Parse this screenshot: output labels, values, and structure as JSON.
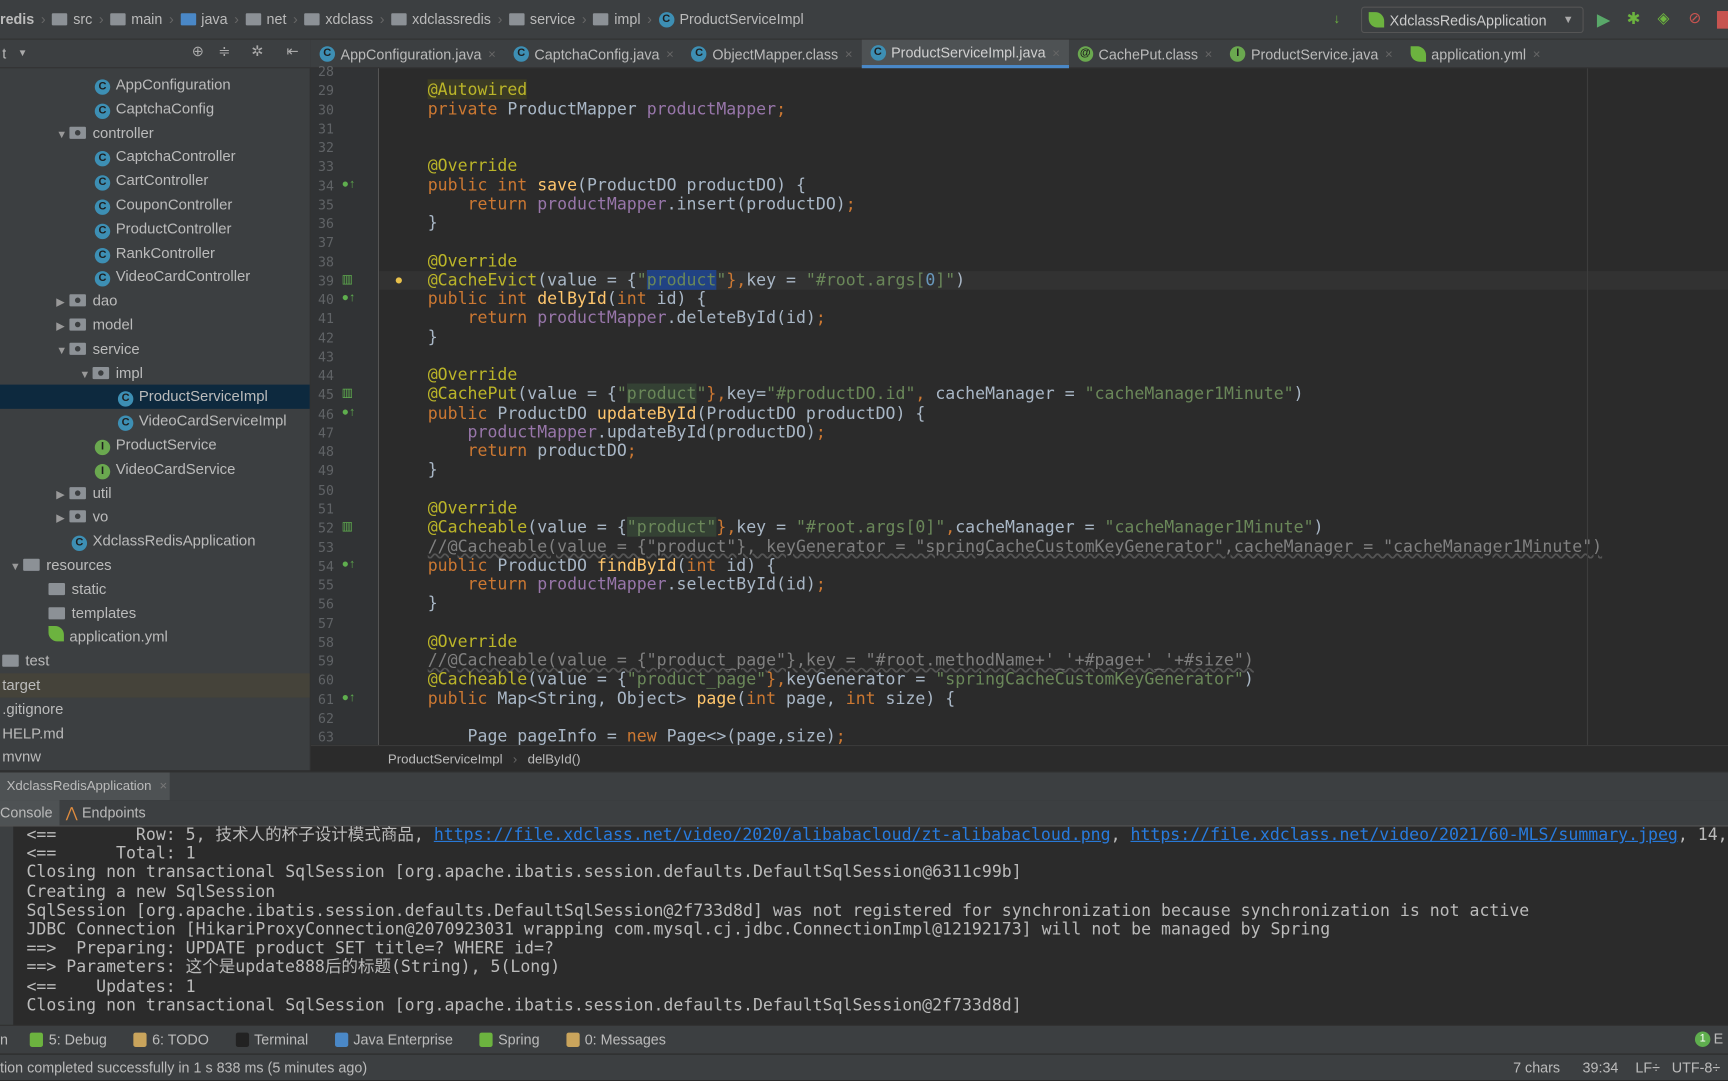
{
  "navbar": {
    "crumbs": [
      {
        "label": "redis",
        "icon": "none"
      },
      {
        "label": "src",
        "icon": "folder-icon"
      },
      {
        "label": "main",
        "icon": "folder-icon"
      },
      {
        "label": "java",
        "icon": "source-folder-icon"
      },
      {
        "label": "net",
        "icon": "package-icon"
      },
      {
        "label": "xdclass",
        "icon": "package-icon"
      },
      {
        "label": "xdclassredis",
        "icon": "package-icon"
      },
      {
        "label": "service",
        "icon": "package-icon"
      },
      {
        "label": "impl",
        "icon": "package-icon"
      },
      {
        "label": "ProductServiceImpl",
        "icon": "class-icon"
      }
    ],
    "run_config": "XdclassRedisApplication"
  },
  "project": {
    "label": "t"
  },
  "tabs": [
    {
      "label": "AppConfiguration.java",
      "icon": "C"
    },
    {
      "label": "CaptchaConfig.java",
      "icon": "C"
    },
    {
      "label": "ObjectMapper.class",
      "icon": "C"
    },
    {
      "label": "ProductServiceImpl.java",
      "icon": "C",
      "active": true
    },
    {
      "label": "CachePut.class",
      "icon": "@"
    },
    {
      "label": "ProductService.java",
      "icon": "I"
    },
    {
      "label": "application.yml",
      "icon": "leaf"
    }
  ],
  "tree": [
    {
      "label": "AppConfiguration",
      "lvl": 4,
      "type": "C"
    },
    {
      "label": "CaptchaConfig",
      "lvl": 4,
      "type": "C"
    },
    {
      "label": "controller",
      "lvl": 3,
      "type": "pkg",
      "open": true
    },
    {
      "label": "CaptchaController",
      "lvl": 4,
      "type": "C"
    },
    {
      "label": "CartController",
      "lvl": 4,
      "type": "C"
    },
    {
      "label": "CouponController",
      "lvl": 4,
      "type": "C"
    },
    {
      "label": "ProductController",
      "lvl": 4,
      "type": "C"
    },
    {
      "label": "RankController",
      "lvl": 4,
      "type": "C"
    },
    {
      "label": "VideoCardController",
      "lvl": 4,
      "type": "C"
    },
    {
      "label": "dao",
      "lvl": 3,
      "type": "pkg",
      "open": false
    },
    {
      "label": "model",
      "lvl": 3,
      "type": "pkg",
      "open": false
    },
    {
      "label": "service",
      "lvl": 3,
      "type": "pkg",
      "open": true
    },
    {
      "label": "impl",
      "lvl": 4,
      "type": "pkg",
      "open": true
    },
    {
      "label": "ProductServiceImpl",
      "lvl": 5,
      "type": "C",
      "selected": true
    },
    {
      "label": "VideoCardServiceImpl",
      "lvl": 5,
      "type": "C"
    },
    {
      "label": "ProductService",
      "lvl": 4,
      "type": "I"
    },
    {
      "label": "VideoCardService",
      "lvl": 4,
      "type": "I"
    },
    {
      "label": "util",
      "lvl": 3,
      "type": "pkg",
      "open": false
    },
    {
      "label": "vo",
      "lvl": 3,
      "type": "pkg",
      "open": false
    },
    {
      "label": "XdclassRedisApplication",
      "lvl": 3,
      "type": "app"
    },
    {
      "label": "resources",
      "lvl": 1,
      "type": "folder",
      "open": true
    },
    {
      "label": "static",
      "lvl": 2,
      "type": "folder"
    },
    {
      "label": "templates",
      "lvl": 2,
      "type": "folder"
    },
    {
      "label": "application.yml",
      "lvl": 2,
      "type": "yml"
    },
    {
      "label": "test",
      "lvl": 0,
      "type": "folder"
    },
    {
      "label": "target",
      "lvl": 0,
      "type": "none",
      "target": true
    },
    {
      "label": ".gitignore",
      "lvl": 0,
      "type": "none"
    },
    {
      "label": "HELP.md",
      "lvl": 0,
      "type": "none"
    },
    {
      "label": "mvnw",
      "lvl": 0,
      "type": "none"
    }
  ],
  "editor": {
    "first_line": 28,
    "current_line": 39,
    "gutter_icons": {
      "34": "override-icon",
      "39": "cache-icon",
      "40": "override-icon",
      "45": "cache-icon",
      "46": "override-icon",
      "52": "cache-icon",
      "54": "override-icon",
      "61": "override-icon"
    },
    "lines": [
      [],
      [
        [
          "    ",
          ""
        ],
        [
          "@Autowired",
          "a abg"
        ]
      ],
      [
        [
          "    ",
          ""
        ],
        [
          "private ",
          "k"
        ],
        [
          "ProductMapper ",
          ""
        ],
        [
          "productMapper",
          "f"
        ],
        [
          ";",
          "k"
        ]
      ],
      [],
      [],
      [
        [
          "    ",
          ""
        ],
        [
          "@Override",
          "a"
        ]
      ],
      [
        [
          "    ",
          ""
        ],
        [
          "public int ",
          "k"
        ],
        [
          "save",
          "m"
        ],
        [
          "(ProductDO productDO) {",
          ""
        ]
      ],
      [
        [
          "        ",
          ""
        ],
        [
          "return ",
          "k"
        ],
        [
          "productMapper",
          "f"
        ],
        [
          ".insert(productDO)",
          ""
        ],
        [
          ";",
          "k"
        ]
      ],
      [
        [
          "    }",
          ""
        ]
      ],
      [],
      [
        [
          "    ",
          ""
        ],
        [
          "@Override",
          "a"
        ]
      ],
      [
        [
          "    ",
          ""
        ],
        [
          "@CacheEvict",
          "a"
        ],
        [
          "(value = {",
          ""
        ],
        [
          "\"",
          "s"
        ],
        [
          "product",
          "s hl"
        ],
        [
          "\"",
          "s"
        ],
        [
          "},",
          "k"
        ],
        [
          "key = ",
          ""
        ],
        [
          "\"#root.args[",
          "s"
        ],
        [
          "0",
          "n"
        ],
        [
          "]\"",
          "s"
        ],
        [
          ")",
          ""
        ]
      ],
      [
        [
          "    ",
          ""
        ],
        [
          "public int ",
          "k"
        ],
        [
          "delById",
          "m"
        ],
        [
          "(",
          ""
        ],
        [
          "int ",
          "k"
        ],
        [
          "id) {",
          ""
        ]
      ],
      [
        [
          "        ",
          ""
        ],
        [
          "return ",
          "k"
        ],
        [
          "productMapper",
          "f"
        ],
        [
          ".deleteById(id)",
          ""
        ],
        [
          ";",
          "k"
        ]
      ],
      [
        [
          "    }",
          ""
        ]
      ],
      [],
      [
        [
          "    ",
          ""
        ],
        [
          "@Override",
          "a"
        ]
      ],
      [
        [
          "    ",
          ""
        ],
        [
          "@CachePut",
          "a"
        ],
        [
          "(value = {",
          ""
        ],
        [
          "\"",
          "s"
        ],
        [
          "product",
          "s hg"
        ],
        [
          "\"",
          "s"
        ],
        [
          "},",
          "k"
        ],
        [
          "key=",
          ""
        ],
        [
          "\"#productDO.id\"",
          "s"
        ],
        [
          ", ",
          "k"
        ],
        [
          "cacheManager = ",
          ""
        ],
        [
          "\"cacheManager1Minute\"",
          "s"
        ],
        [
          ")",
          ""
        ]
      ],
      [
        [
          "    ",
          ""
        ],
        [
          "public ",
          "k"
        ],
        [
          "ProductDO ",
          ""
        ],
        [
          "updateById",
          "m"
        ],
        [
          "(ProductDO productDO) {",
          ""
        ]
      ],
      [
        [
          "        ",
          ""
        ],
        [
          "productMapper",
          "f"
        ],
        [
          ".updateById(productDO)",
          ""
        ],
        [
          ";",
          "k"
        ]
      ],
      [
        [
          "        ",
          ""
        ],
        [
          "return ",
          "k"
        ],
        [
          "productDO",
          ""
        ],
        [
          ";",
          "k"
        ]
      ],
      [
        [
          "    }",
          ""
        ]
      ],
      [],
      [
        [
          "    ",
          ""
        ],
        [
          "@Override",
          "a"
        ]
      ],
      [
        [
          "    ",
          ""
        ],
        [
          "@Cacheable",
          "a"
        ],
        [
          "(value = {",
          ""
        ],
        [
          "\"product\"",
          "s hg"
        ],
        [
          "},",
          "k"
        ],
        [
          "key = ",
          ""
        ],
        [
          "\"#root.args[0]\"",
          "s"
        ],
        [
          ",",
          "k"
        ],
        [
          "cacheManager = ",
          ""
        ],
        [
          "\"cacheManager1Minute\"",
          "s"
        ],
        [
          ")",
          ""
        ]
      ],
      [
        [
          "    ",
          ""
        ],
        [
          "//@Cacheable(value = {\"product\"}, keyGenerator = \"springCacheCustomKeyGenerator\",cacheManager = \"cacheManager1Minute\")",
          "c"
        ]
      ],
      [
        [
          "    ",
          ""
        ],
        [
          "public ",
          "k"
        ],
        [
          "ProductDO ",
          ""
        ],
        [
          "findById",
          "m"
        ],
        [
          "(",
          ""
        ],
        [
          "int ",
          "k"
        ],
        [
          "id) {",
          ""
        ]
      ],
      [
        [
          "        ",
          ""
        ],
        [
          "return ",
          "k"
        ],
        [
          "productMapper",
          "f"
        ],
        [
          ".selectById(id)",
          ""
        ],
        [
          ";",
          "k"
        ]
      ],
      [
        [
          "    }",
          ""
        ]
      ],
      [],
      [
        [
          "    ",
          ""
        ],
        [
          "@Override",
          "a"
        ]
      ],
      [
        [
          "    ",
          ""
        ],
        [
          "//@Cacheable(value = {\"product_page\"},key = \"#root.methodName+'_'+#page+'_'+#size\")",
          "c"
        ]
      ],
      [
        [
          "    ",
          ""
        ],
        [
          "@Cacheable",
          "a"
        ],
        [
          "(value = {",
          ""
        ],
        [
          "\"product_page\"",
          "s"
        ],
        [
          "},",
          "k"
        ],
        [
          "keyGenerator = ",
          ""
        ],
        [
          "\"springCacheCustomKeyGenerator\"",
          "s"
        ],
        [
          ")",
          ""
        ]
      ],
      [
        [
          "    ",
          ""
        ],
        [
          "public ",
          "k"
        ],
        [
          "Map<String, Object> ",
          ""
        ],
        [
          "page",
          "m"
        ],
        [
          "(",
          ""
        ],
        [
          "int ",
          "k"
        ],
        [
          "page, ",
          ""
        ],
        [
          "int ",
          "k"
        ],
        [
          "size) {",
          ""
        ]
      ],
      [],
      [
        [
          "        ",
          ""
        ],
        [
          "Page pageInfo = ",
          ""
        ],
        [
          "new ",
          "k"
        ],
        [
          "Page<>(page,size)",
          ""
        ],
        [
          ";",
          "k"
        ]
      ]
    ]
  },
  "editor_breadcrumb": [
    "ProductServiceImpl",
    "delById()"
  ],
  "run_tab": "XdclassRedisApplication",
  "console_tabs": [
    "Console",
    "Endpoints"
  ],
  "console": [
    [
      [
        "<==        Row: 5, 技术人的杯子设计模式商品, ",
        ""
      ],
      [
        "https://file.xdclass.net/video/2020/alibabacloud/zt-alibabacloud.png",
        "u"
      ],
      [
        ", ",
        ""
      ],
      [
        "https://file.xdclass.net/video/2021/60-MLS/summary.jpeg",
        "u"
      ],
      [
        ", 14,",
        ""
      ]
    ],
    [
      [
        "<==      Total: 1",
        ""
      ]
    ],
    [
      [
        "Closing non transactional SqlSession [org.apache.ibatis.session.defaults.DefaultSqlSession@6311c99b]",
        ""
      ]
    ],
    [
      [
        "Creating a new SqlSession",
        ""
      ]
    ],
    [
      [
        "SqlSession [org.apache.ibatis.session.defaults.DefaultSqlSession@2f733d8d] was not registered for synchronization because synchronization is not active",
        ""
      ]
    ],
    [
      [
        "JDBC Connection [HikariProxyConnection@2070923031 wrapping com.mysql.cj.jdbc.ConnectionImpl@12192173] will not be managed by Spring",
        ""
      ]
    ],
    [
      [
        "==>  Preparing: UPDATE product SET title=? WHERE id=?",
        ""
      ]
    ],
    [
      [
        "==> Parameters: 这个是update888后的标题(String), 5(Long)",
        ""
      ]
    ],
    [
      [
        "<==    Updates: 1",
        ""
      ]
    ],
    [
      [
        "Closing non transactional SqlSession [org.apache.ibatis.session.defaults.DefaultSqlSession@2f733d8d]",
        ""
      ]
    ]
  ],
  "toolwindows": [
    {
      "label": "n",
      "color": "none"
    },
    {
      "label": "5: Debug",
      "color": "#6cb33f"
    },
    {
      "label": "6: TODO",
      "color": "#c9a45c"
    },
    {
      "label": "Terminal",
      "color": "#222"
    },
    {
      "label": "Java Enterprise",
      "color": "#4a88c7"
    },
    {
      "label": "Spring",
      "color": "#6cb33f"
    },
    {
      "label": "0: Messages",
      "color": "#c9a45c"
    }
  ],
  "event_log": {
    "badge": "1",
    "label": "E"
  },
  "status": {
    "message": "tion completed successfully in 1 s 838 ms (5 minutes ago)",
    "chars": "7 chars",
    "position": "39:34",
    "line_sep": "LF÷",
    "encoding": "UTF-8÷"
  }
}
